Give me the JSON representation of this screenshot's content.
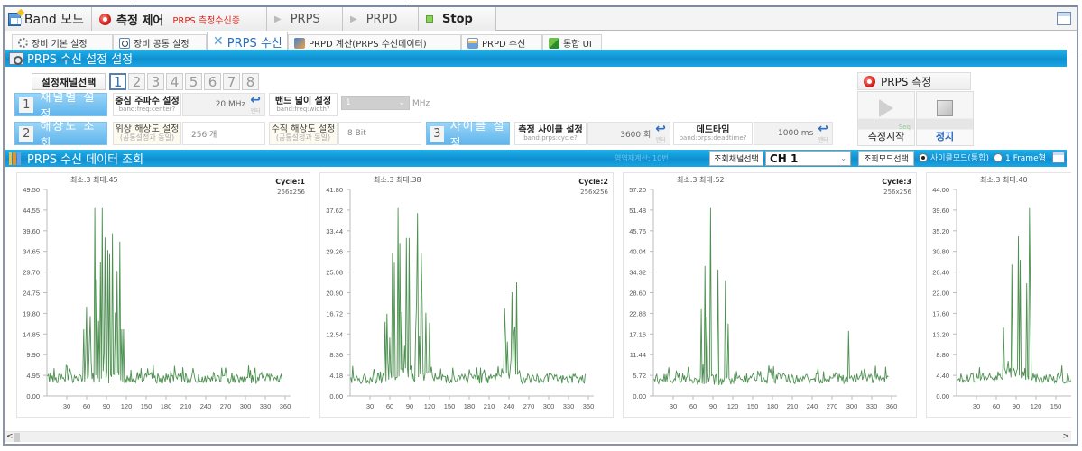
{
  "mode_bar": {
    "band_mode_label": "Band 모드",
    "measure_control_label": "측정 제어",
    "measure_status": "PRPS 측정수신중",
    "prps_label": "PRPS",
    "prpd_label": "PRPD",
    "stop_label": "Stop"
  },
  "sub_tabs": [
    {
      "label": "장비 기본 설정",
      "icon": "gear-icon",
      "active": false
    },
    {
      "label": "장비 공통 설정",
      "icon": "magnifier-icon",
      "active": false
    },
    {
      "label": "PRPS 수신",
      "icon": "signal-icon",
      "active": true
    },
    {
      "label": "PRPD 계산(PRPS 수신데이터)",
      "icon": "prpd-icon",
      "active": false
    },
    {
      "label": "PRPD 수신",
      "icon": "chart-icon",
      "active": false
    },
    {
      "label": "통합 UI",
      "icon": "integrated-icon",
      "active": false
    }
  ],
  "settings_section": {
    "title": "PRPS 수신 설정 설정",
    "channel_select_label": "설정채널선택",
    "channels": [
      "1",
      "2",
      "3",
      "4",
      "5",
      "6",
      "7",
      "8"
    ],
    "selected_channel": "1",
    "step1": {
      "num": "1",
      "label": "채널별 설정"
    },
    "step2": {
      "num": "2",
      "label": "해상도 조회"
    },
    "step3": {
      "num": "3",
      "label": "사이클 설정"
    },
    "center_freq": {
      "label": "중심 주파수 설정",
      "cmd": "band:freq:center?",
      "value": "20 MHz",
      "enter": "엔터"
    },
    "bandwidth": {
      "label": "밴드 넓이 설정",
      "cmd": "band:freq:width?",
      "value": "1",
      "unit": "MHz"
    },
    "phase_res": {
      "label": "위상 해상도 설정",
      "sub": "(공통설정과 동일)",
      "value": "256 개"
    },
    "vert_res": {
      "label": "수직 해상도 설정",
      "sub": "(공통설정과 동일)",
      "value": "8 Bit"
    },
    "cycle": {
      "label": "측정 사이클 설정",
      "cmd": "band:prps:cycle?",
      "value": "3600 회",
      "enter": "엔터"
    },
    "deadtime": {
      "label": "데드타임",
      "cmd": "band:prps:deadtime?",
      "value": "1000 ms",
      "enter": "엔터"
    }
  },
  "prps_measure": {
    "title": "PRPS 측정",
    "start_label": "측정시작",
    "seq_label": "Seq",
    "stop_label": "정지"
  },
  "data_section": {
    "title": "PRPS 수신 데이터 조회",
    "recalc_text": "영역재계산: 10번",
    "view_channel_label": "조회채널선택",
    "view_channel_value": "CH 1",
    "view_mode_label": "조회모드선택",
    "mode_cycle_label": "사이클모드(통합)",
    "mode_frame_label": "1 Frame형",
    "selected_mode": "cycle"
  },
  "chart_data": [
    {
      "type": "line",
      "minmax_label": "최소:3 최대:45",
      "cycle_label": "Cycle:1",
      "resolution_label": "256x256",
      "ylim": [
        0,
        49.5
      ],
      "yticks": [
        "0.00",
        "4.95",
        "9.90",
        "14.85",
        "19.80",
        "24.75",
        "29.70",
        "34.65",
        "39.60",
        "44.55",
        "49.50"
      ],
      "xlim": [
        0,
        360
      ],
      "xticks": [
        "30",
        "60",
        "90",
        "120",
        "150",
        "180",
        "210",
        "240",
        "270",
        "300",
        "330",
        "360"
      ],
      "color": "#2e7d32",
      "peaks": [
        [
          56,
          16
        ],
        [
          58,
          9
        ],
        [
          72,
          45
        ],
        [
          75,
          28
        ],
        [
          78,
          18
        ],
        [
          81,
          32
        ],
        [
          84,
          45
        ],
        [
          88,
          38
        ],
        [
          92,
          35
        ],
        [
          95,
          34
        ],
        [
          99,
          39
        ],
        [
          103,
          20
        ],
        [
          106,
          30
        ],
        [
          110,
          37
        ],
        [
          113,
          16
        ],
        [
          116,
          16
        ]
      ],
      "burst": [
        55,
        120
      ],
      "burst2": null,
      "extra_spike": null
    },
    {
      "type": "line",
      "minmax_label": "최소:3 최대:38",
      "cycle_label": "Cycle:2",
      "resolution_label": "256x256",
      "ylim": [
        0,
        41.8
      ],
      "yticks": [
        "0.00",
        "4.18",
        "8.36",
        "12.54",
        "16.72",
        "20.90",
        "25.08",
        "29.26",
        "33.44",
        "37.62",
        "41.80"
      ],
      "xlim": [
        0,
        360
      ],
      "xticks": [
        "30",
        "60",
        "90",
        "120",
        "150",
        "180",
        "210",
        "240",
        "270",
        "300",
        "330",
        "360"
      ],
      "color": "#2e7d32",
      "peaks": [
        [
          53,
          15
        ],
        [
          64,
          29
        ],
        [
          67,
          27
        ],
        [
          72,
          38
        ],
        [
          75,
          31
        ],
        [
          78,
          17
        ],
        [
          80,
          36
        ],
        [
          85,
          32
        ],
        [
          89,
          32
        ],
        [
          94,
          25
        ],
        [
          97,
          28
        ],
        [
          102,
          37
        ],
        [
          107,
          29
        ],
        [
          111,
          28
        ],
        [
          122,
          17
        ]
      ],
      "burst": [
        52,
        125
      ],
      "burst2": [
        [
          235,
          12
        ],
        [
          238,
          11
        ],
        [
          241,
          14
        ],
        [
          245,
          21
        ],
        [
          249,
          14
        ],
        [
          252,
          23
        ],
        [
          255,
          19
        ]
      ],
      "extra_spike": null
    },
    {
      "type": "line",
      "minmax_label": "최소:3 최대:52",
      "cycle_label": "Cycle:3",
      "resolution_label": "256x256",
      "ylim": [
        0,
        57.2
      ],
      "yticks": [
        "0.00",
        "5.72",
        "11.44",
        "17.16",
        "22.88",
        "28.60",
        "34.32",
        "40.04",
        "45.76",
        "51.48",
        "57.20"
      ],
      "xlim": [
        0,
        360
      ],
      "xticks": [
        "30",
        "60",
        "90",
        "120",
        "150",
        "180",
        "210",
        "240",
        "270",
        "300",
        "330",
        "360"
      ],
      "color": "#2e7d32",
      "peaks": [
        [
          66,
          32
        ],
        [
          72,
          24
        ],
        [
          78,
          36
        ],
        [
          81,
          22
        ],
        [
          86,
          52
        ],
        [
          90,
          41
        ],
        [
          94,
          26
        ],
        [
          98,
          35
        ],
        [
          101,
          31
        ],
        [
          104,
          20
        ],
        [
          109,
          32
        ],
        [
          113,
          20
        ]
      ],
      "burst": [
        64,
        118
      ],
      "burst2": null,
      "extra_spike": [
        295,
        18
      ]
    },
    {
      "type": "line",
      "minmax_label": "최소:3 최대:40",
      "cycle_label": "",
      "resolution_label": "",
      "ylim": [
        0,
        44
      ],
      "yticks": [
        "0.00",
        "4.40",
        "8.80",
        "13.20",
        "17.60",
        "22.00",
        "26.40",
        "30.80",
        "35.20",
        "39.60",
        "44.00"
      ],
      "xlim": [
        0,
        360
      ],
      "xticks": [
        "30",
        "60",
        "90",
        "120",
        "150"
      ],
      "color": "#2e7d32",
      "peaks": [
        [
          59,
          22
        ],
        [
          62,
          19
        ],
        [
          69,
          30
        ],
        [
          73,
          20
        ],
        [
          76,
          33
        ],
        [
          80,
          38
        ],
        [
          84,
          28
        ],
        [
          87,
          32
        ],
        [
          90,
          37
        ],
        [
          93,
          34
        ],
        [
          96,
          29
        ],
        [
          101,
          29
        ],
        [
          106,
          24
        ],
        [
          110,
          40
        ],
        [
          115,
          26
        ]
      ],
      "burst": [
        58,
        118
      ],
      "burst2": null,
      "extra_spike": null
    }
  ]
}
